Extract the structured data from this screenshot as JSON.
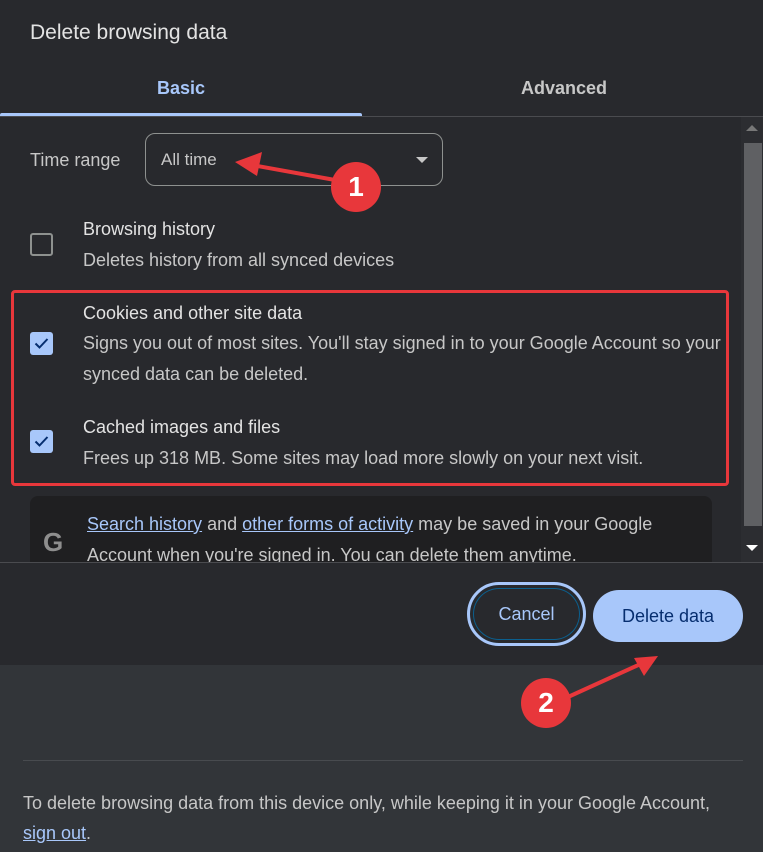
{
  "dialog": {
    "title": "Delete browsing data",
    "tabs": [
      {
        "label": "Basic",
        "active": true
      },
      {
        "label": "Advanced",
        "active": false
      }
    ],
    "time_range": {
      "label": "Time range",
      "selected": "All time"
    },
    "options": [
      {
        "title": "Browsing history",
        "description": "Deletes history from all synced devices",
        "checked": false
      },
      {
        "title": "Cookies and other site data",
        "description": "Signs you out of most sites. You'll stay signed in to your Google Account so your synced data can be deleted.",
        "checked": true
      },
      {
        "title": "Cached images and files",
        "description": "Frees up 318 MB. Some sites may load more slowly on your next visit.",
        "checked": true
      }
    ],
    "google_notice": {
      "icon": "google-g-icon",
      "link1": "Search history",
      "text1": " and ",
      "link2": "other forms of activity",
      "text2": " may be saved in your Google Account when you're signed in. You can delete them anytime."
    },
    "buttons": {
      "cancel": "Cancel",
      "delete": "Delete data"
    }
  },
  "footer": {
    "text": "To delete browsing data from this device only, while keeping it in your Google Account, ",
    "link": "sign out",
    "suffix": "."
  },
  "annotations": {
    "badge1": "1",
    "badge2": "2",
    "color": "#e8373b"
  },
  "colors": {
    "accent": "#a8c7fa",
    "dialog_bg": "#28292d",
    "page_bg": "#323539"
  }
}
